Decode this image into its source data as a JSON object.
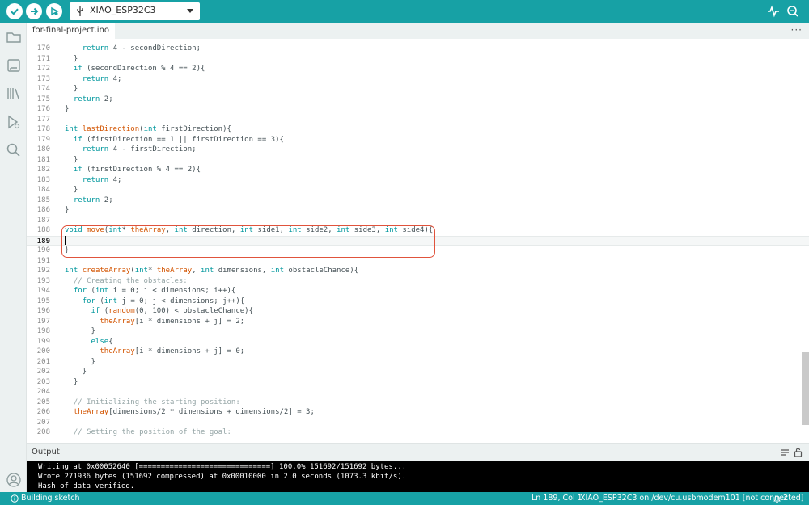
{
  "toolbar": {
    "verify_icon": "check-icon",
    "upload_icon": "arrow-right-icon",
    "debug_icon": "debug-play-icon",
    "board_name": "XIAO_ESP32C3",
    "serial_plotter_icon": "pulse-icon",
    "serial_monitor_icon": "magnifier-dots-icon"
  },
  "sidebar": {
    "icons": [
      "folder-icon",
      "boards-manager-icon",
      "library-icon",
      "debug-icon",
      "search-icon",
      "account-icon"
    ]
  },
  "tab": {
    "label": "for-final-project.ino",
    "more_label": "···"
  },
  "editor": {
    "lines": [
      {
        "n": "170",
        "code": "    return 4 - secondDirection;"
      },
      {
        "n": "171",
        "code": "  }"
      },
      {
        "n": "172",
        "code": "  if (secondDirection % 4 == 2){"
      },
      {
        "n": "173",
        "code": "    return 4;"
      },
      {
        "n": "174",
        "code": "  }"
      },
      {
        "n": "175",
        "code": "  return 2;"
      },
      {
        "n": "176",
        "code": "}"
      },
      {
        "n": "177",
        "code": ""
      },
      {
        "n": "178",
        "code": "int lastDirection(int firstDirection){"
      },
      {
        "n": "179",
        "code": "  if (firstDirection == 1 || firstDirection == 3){"
      },
      {
        "n": "180",
        "code": "    return 4 - firstDirection;"
      },
      {
        "n": "181",
        "code": "  }"
      },
      {
        "n": "182",
        "code": "  if (firstDirection % 4 == 2){"
      },
      {
        "n": "183",
        "code": "    return 4;"
      },
      {
        "n": "184",
        "code": "  }"
      },
      {
        "n": "185",
        "code": "  return 2;"
      },
      {
        "n": "186",
        "code": "}"
      },
      {
        "n": "187",
        "code": ""
      },
      {
        "n": "188",
        "code": "void move(int* theArray, int direction, int side1, int side2, int side3, int side4){"
      },
      {
        "n": "189",
        "code": ""
      },
      {
        "n": "190",
        "code": "}"
      },
      {
        "n": "191",
        "code": ""
      },
      {
        "n": "192",
        "code": "int createArray(int* theArray, int dimensions, int obstacleChance){"
      },
      {
        "n": "193",
        "code": "  // Creating the obstacles:"
      },
      {
        "n": "194",
        "code": "  for (int i = 0; i < dimensions; i++){"
      },
      {
        "n": "195",
        "code": "    for (int j = 0; j < dimensions; j++){"
      },
      {
        "n": "196",
        "code": "      if (random(0, 100) < obstacleChance){"
      },
      {
        "n": "197",
        "code": "        theArray[i * dimensions + j] = 2;"
      },
      {
        "n": "198",
        "code": "      }"
      },
      {
        "n": "199",
        "code": "      else{"
      },
      {
        "n": "200",
        "code": "        theArray[i * dimensions + j] = 0;"
      },
      {
        "n": "201",
        "code": "      }"
      },
      {
        "n": "202",
        "code": "    }"
      },
      {
        "n": "203",
        "code": "  }"
      },
      {
        "n": "204",
        "code": ""
      },
      {
        "n": "205",
        "code": "  // Initializing the starting position:"
      },
      {
        "n": "206",
        "code": "  theArray[dimensions/2 * dimensions + dimensions/2] = 3;"
      },
      {
        "n": "207",
        "code": ""
      },
      {
        "n": "208",
        "code": "  // Setting the position of the goal:"
      }
    ],
    "active_line": "189"
  },
  "output": {
    "title": "Output",
    "lines": [
      "Writing at 0x00052640 [==============================] 100.0% 151692/151692 bytes...",
      "Wrote 271936 bytes (151692 compressed) at 0x00010000 in 2.0 seconds (1073.3 kbit/s).",
      "Hash of data verified."
    ]
  },
  "status": {
    "building": "Building sketch",
    "position": "Ln 189, Col 1",
    "port": "XIAO_ESP32C3 on /dev/cu.usbmodem101 [not connected]",
    "notifications": "2"
  },
  "colors": {
    "accent": "#17a1a5",
    "keyword": "#00979d",
    "function": "#d35400",
    "comment": "#95a5a6",
    "highlight_box": "#e0533c"
  }
}
